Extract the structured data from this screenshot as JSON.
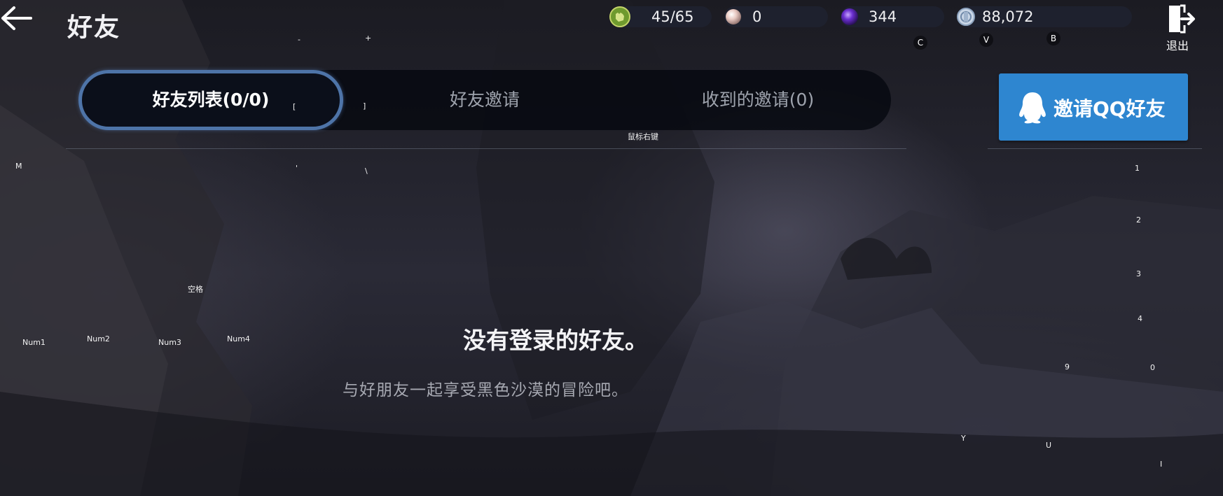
{
  "header": {
    "title": "好友",
    "exit_label": "退出"
  },
  "currencies": [
    {
      "name": "energy",
      "icon": "fist-badge-icon",
      "value": "45/65"
    },
    {
      "name": "pearl",
      "icon": "pearl-icon",
      "value": "0"
    },
    {
      "name": "purple-orb",
      "icon": "purple-orb-icon",
      "value": "344"
    },
    {
      "name": "silver",
      "icon": "silver-coin-icon",
      "value": "88,072"
    }
  ],
  "tabs": [
    {
      "label": "好友列表(0/0)",
      "active": true
    },
    {
      "label": "好友邀请",
      "active": false
    },
    {
      "label": "收到的邀请(0)",
      "active": false
    }
  ],
  "qq_invite": {
    "label": "邀请QQ好友"
  },
  "empty_state": {
    "title": "没有登录的好友。",
    "subtitle": "与好朋友一起享受黑色沙漠的冒险吧。"
  },
  "key_hints": {
    "minus": "-",
    "plus": "+",
    "c": "C",
    "v": "V",
    "b": "B",
    "lbracket": "[",
    "rbracket": "]",
    "right_click": "鼠标右键",
    "m": "M",
    "apostrophe": "'",
    "backslash": "\\",
    "space": "空格",
    "num1": "Num1",
    "num2": "Num2",
    "num3": "Num3",
    "num4": "Num4",
    "k1": "1",
    "k2": "2",
    "k3": "3",
    "k4": "4",
    "k9": "9",
    "k0": "0",
    "y": "Y",
    "u": "U",
    "i": "I"
  },
  "colors": {
    "accent_blue": "#2e86d0",
    "active_ring": "#4e74a8",
    "tab_bar_bg": "#06080f"
  }
}
